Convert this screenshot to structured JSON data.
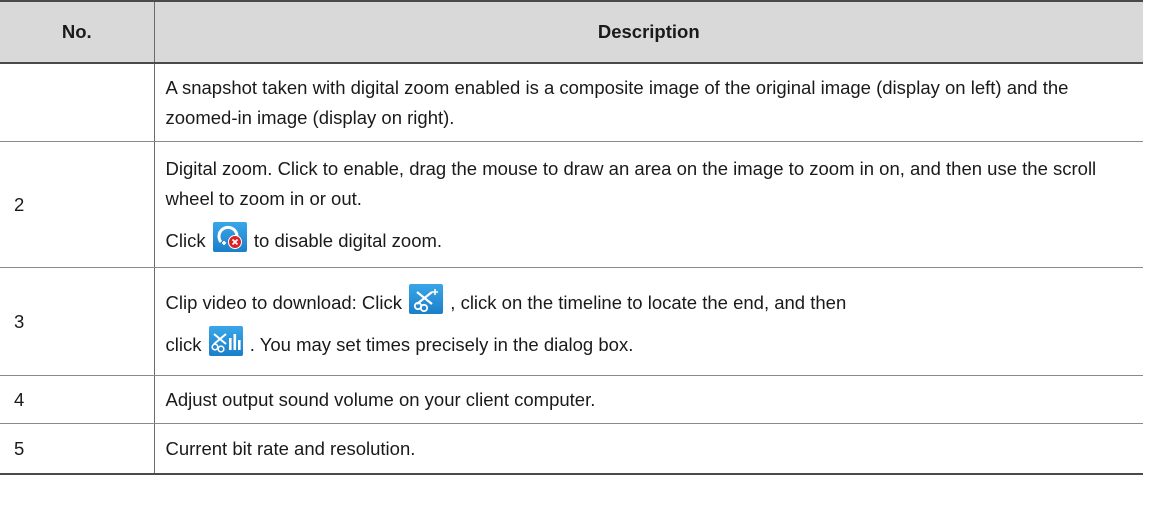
{
  "table": {
    "headers": {
      "no": "No.",
      "description": "Description"
    },
    "rows": [
      {
        "no": "",
        "paragraphs": [
          "A snapshot taken with digital zoom enabled is a composite image of the original image (display on left) and the zoomed-in image (display on right)."
        ]
      },
      {
        "no": "2",
        "paragraphs": [
          "Digital zoom. Click to enable, drag the mouse to draw an area on the image to zoom in on, and then use the scroll wheel to zoom in or out."
        ],
        "icon_line": {
          "before": "Click",
          "icon": "disable-digital-zoom-icon",
          "after": "to disable digital zoom."
        }
      },
      {
        "no": "3",
        "line1": {
          "before": "Clip video to download: Click",
          "icon": "clip-start-icon",
          "after": ", click on the timeline to locate the end, and then"
        },
        "line2": {
          "before": "click",
          "icon": "clip-end-icon",
          "after": ". You may set times precisely in the dialog box."
        }
      },
      {
        "no": "4",
        "paragraphs": [
          "Adjust output sound volume on your client computer."
        ]
      },
      {
        "no": "5",
        "paragraphs": [
          "Current bit rate and resolution."
        ]
      }
    ]
  },
  "colors": {
    "header_bg": "#d9d9d9",
    "icon_blue": "#1c7fc9",
    "icon_red": "#e02020"
  }
}
